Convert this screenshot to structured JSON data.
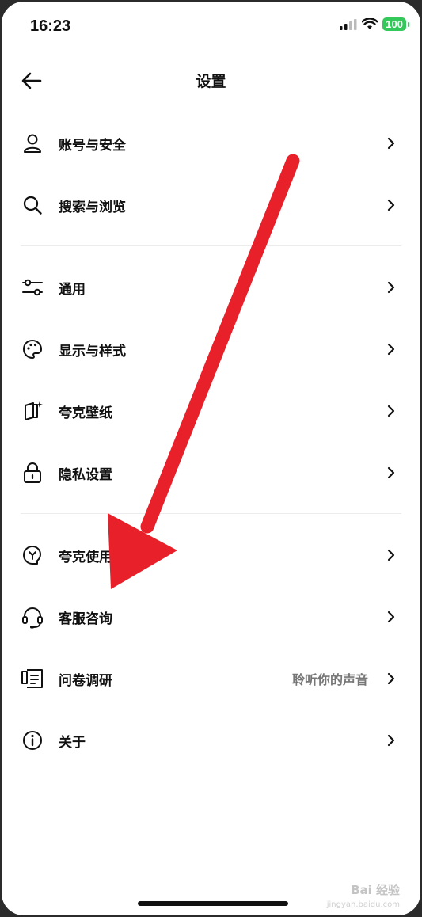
{
  "status_bar": {
    "time": "16:23",
    "battery": "100",
    "battery_color": "#34c759"
  },
  "header": {
    "title": "设置",
    "back_icon": "arrow-left-icon"
  },
  "sections": [
    [
      {
        "label": "账号与安全",
        "icon": "user-icon"
      },
      {
        "label": "搜索与浏览",
        "icon": "search-icon"
      }
    ],
    [
      {
        "label": "通用",
        "icon": "sliders-icon"
      },
      {
        "label": "显示与样式",
        "icon": "palette-icon"
      },
      {
        "label": "夸克壁纸",
        "icon": "wallpaper-icon"
      },
      {
        "label": "隐私设置",
        "icon": "lock-icon"
      }
    ],
    [
      {
        "label": "夸克使用",
        "icon": "lightbulb-icon"
      },
      {
        "label": "客服咨询",
        "icon": "headset-icon"
      },
      {
        "label": "问卷调研",
        "icon": "survey-icon",
        "hint": "聆听你的声音"
      },
      {
        "label": "关于",
        "icon": "info-icon"
      }
    ]
  ],
  "overlay": {
    "annotation": "red-arrow-annotation",
    "arrow_color": "#e8202a"
  },
  "watermark": {
    "text": "Bai 经验",
    "url": "jingyan.baidu.com"
  }
}
